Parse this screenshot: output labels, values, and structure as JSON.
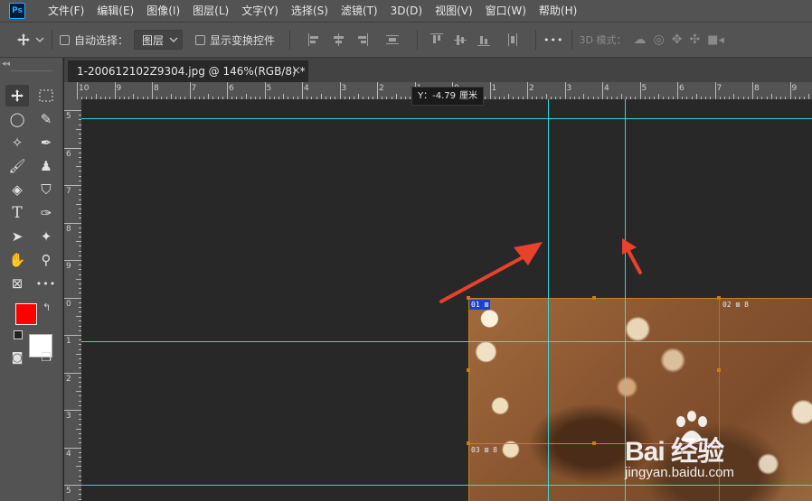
{
  "app": {
    "logo_text": "Ps"
  },
  "menu": [
    "文件(F)",
    "编辑(E)",
    "图像(I)",
    "图层(L)",
    "文字(Y)",
    "选择(S)",
    "滤镜(T)",
    "3D(D)",
    "视图(V)",
    "窗口(W)",
    "帮助(H)"
  ],
  "options": {
    "auto_select_label": "自动选择：",
    "auto_select_value": "图层",
    "show_transform_label": "显示变换控件",
    "more_label": "•••",
    "mode_3d_label": "3D 模式："
  },
  "toolbar": {
    "grip": "◂◂",
    "active_tool": "move-tool"
  },
  "document_tab": {
    "title": "1-200612102Z9304.jpg @ 146%(RGB/8) *",
    "close": "×"
  },
  "rulers": {
    "horizontal_labels": [
      "10",
      "9",
      "8",
      "7",
      "6",
      "5",
      "4",
      "3",
      "2",
      "1",
      "0",
      "1",
      "2",
      "3",
      "4",
      "5",
      "6",
      "7",
      "8",
      "9"
    ],
    "vertical_labels": [
      "5",
      "6",
      "7",
      "8",
      "9",
      "0",
      "1",
      "2",
      "3",
      "4",
      "5"
    ]
  },
  "tooltip": {
    "label": "Y：-4.79",
    "unit": "厘米"
  },
  "slices": [
    {
      "tag": "01",
      "state": "selected"
    },
    {
      "tag": "02",
      "state": "auto"
    },
    {
      "tag": "03",
      "state": "auto"
    }
  ],
  "slice_tag_text": {
    "s01": "01 ⊠",
    "s02": "02 ⊠ 8",
    "s03": "03 ⊠ 8"
  },
  "colors": {
    "foreground": "#ff0000",
    "background": "#ffffff",
    "guide": "#2ee8ee",
    "slice_line": "#c47f1b",
    "arrow": "#e8412c"
  },
  "watermark": {
    "main": "Bai 经验",
    "sub": "jingyan.baidu.com"
  }
}
